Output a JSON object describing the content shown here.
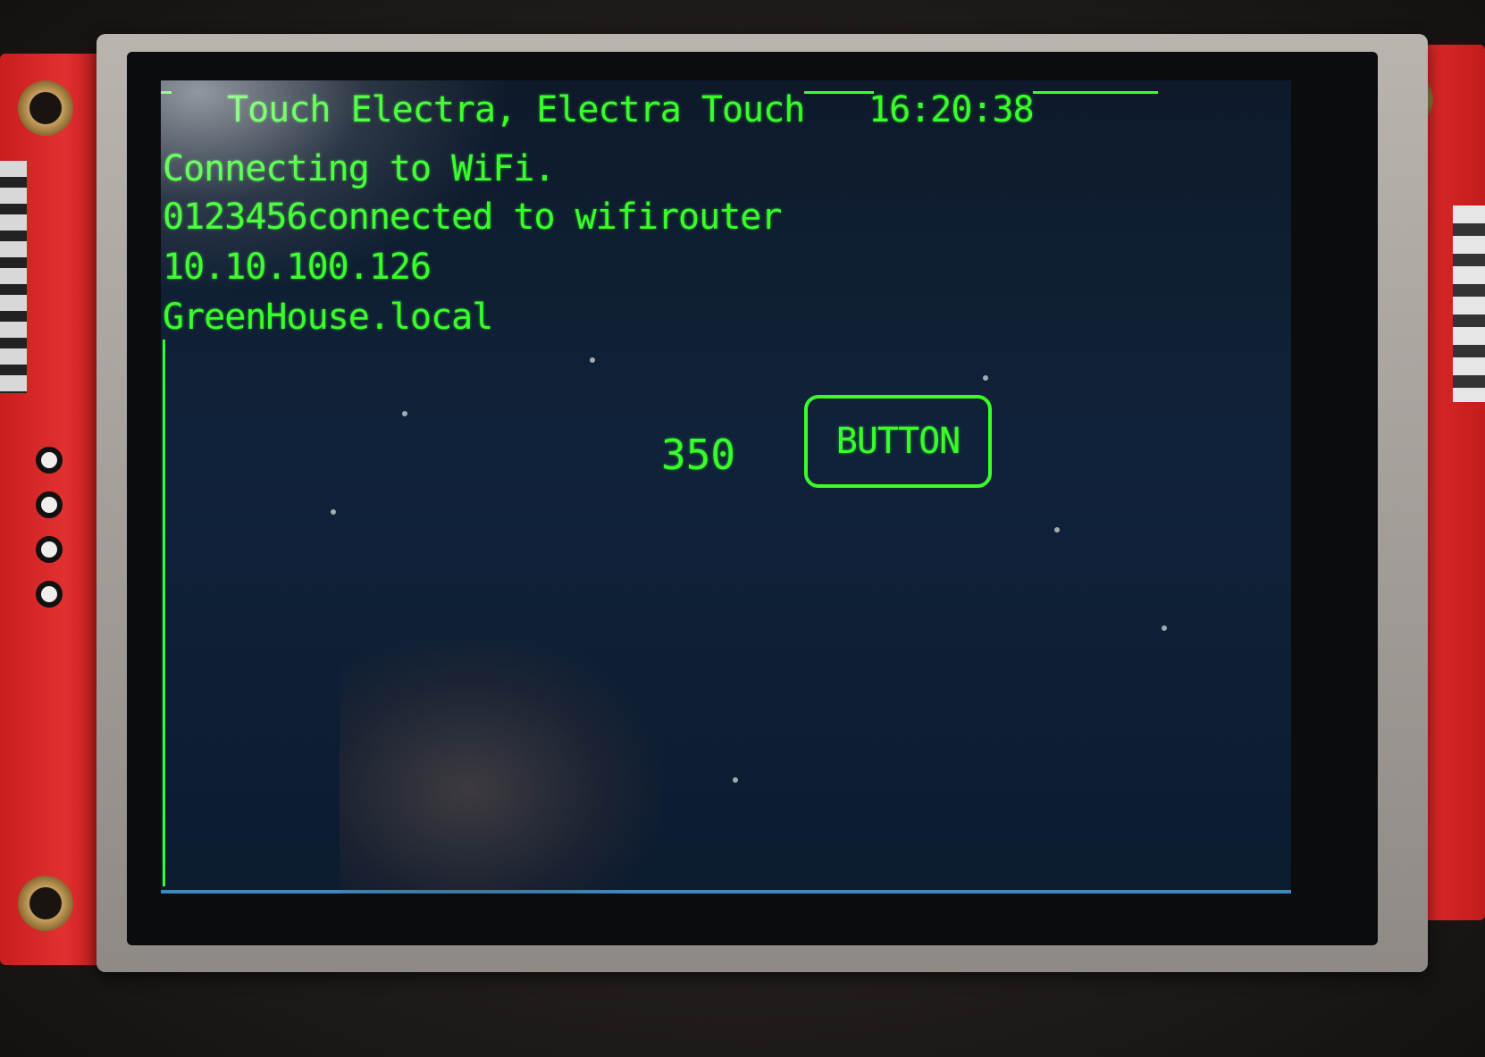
{
  "device": {
    "board_color": "#e02a2a",
    "screen_color": "#10223a",
    "text_color": "#39ff2a"
  },
  "screen": {
    "title": "Touch Electra, Electra Touch",
    "clock": "16:20:38",
    "log": [
      "Connecting to WiFi.",
      "0123456connected to wifirouter",
      "10.10.100.126",
      "GreenHouse.local"
    ],
    "counter": "350",
    "button_label": "BUTTON"
  }
}
